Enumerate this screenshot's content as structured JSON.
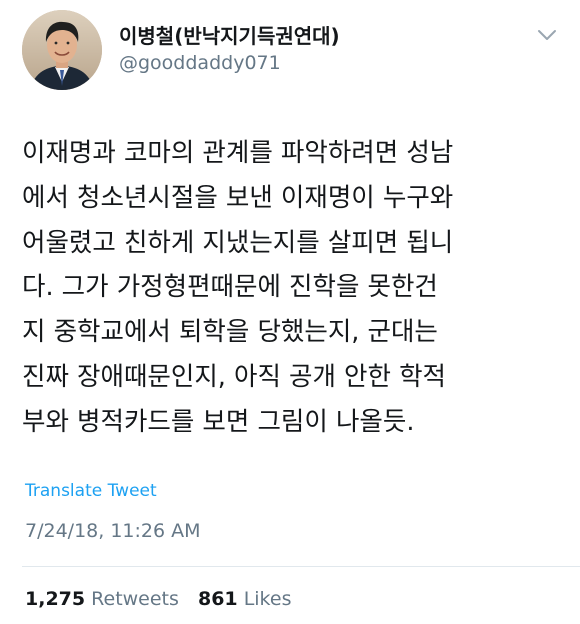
{
  "user": {
    "display_name": "이병철(반낙지기득권연대)",
    "handle": "@gooddaddy071"
  },
  "tweet": {
    "lines": [
      "이재명과 코마의 관계를 파악하려면 성남",
      "에서 청소년시절을 보낸 이재명이 누구와",
      "어울렸고 친하게 지냈는지를 살피면 됩니",
      "다. 그가 가정형편때문에 진학을 못한건",
      "지 중학교에서 퇴학을 당했는지, 군대는",
      "진짜 장애때문인지, 아직 공개 안한 학적",
      "부와 병적카드를 보면 그림이 나올듯."
    ],
    "translate_label": "Translate Tweet",
    "timestamp": "7/24/18, 11:26 AM"
  },
  "stats": {
    "retweets_count": "1,275",
    "retweets_label": "Retweets",
    "likes_count": "861",
    "likes_label": "Likes"
  },
  "icons": {
    "menu": "chevron-down-icon"
  },
  "colors": {
    "text": "#14171a",
    "secondary": "#657786",
    "link": "#1da1f2",
    "divider": "#e1e8ed"
  }
}
